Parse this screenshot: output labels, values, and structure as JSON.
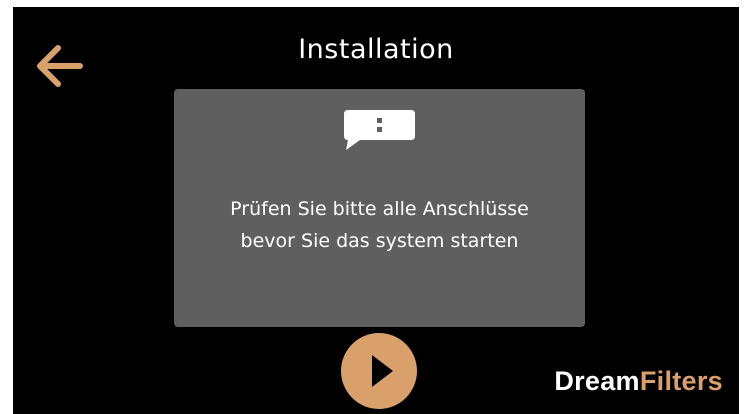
{
  "header": {
    "title": "Installation",
    "back_icon": "arrow-left-icon"
  },
  "dialog": {
    "icon": "chat-alert-icon",
    "message_lines": [
      "Prüfen Sie bitte alle Anschlüsse",
      "bevor Sie das system starten"
    ]
  },
  "footer": {
    "play_icon": "play-icon",
    "logo": {
      "part1": "Dream",
      "part2": "Filters"
    }
  },
  "colors": {
    "background": "#000000",
    "accent": "#d9a06b",
    "dialog_bg": "#5f5f5f",
    "text": "#ffffff"
  }
}
